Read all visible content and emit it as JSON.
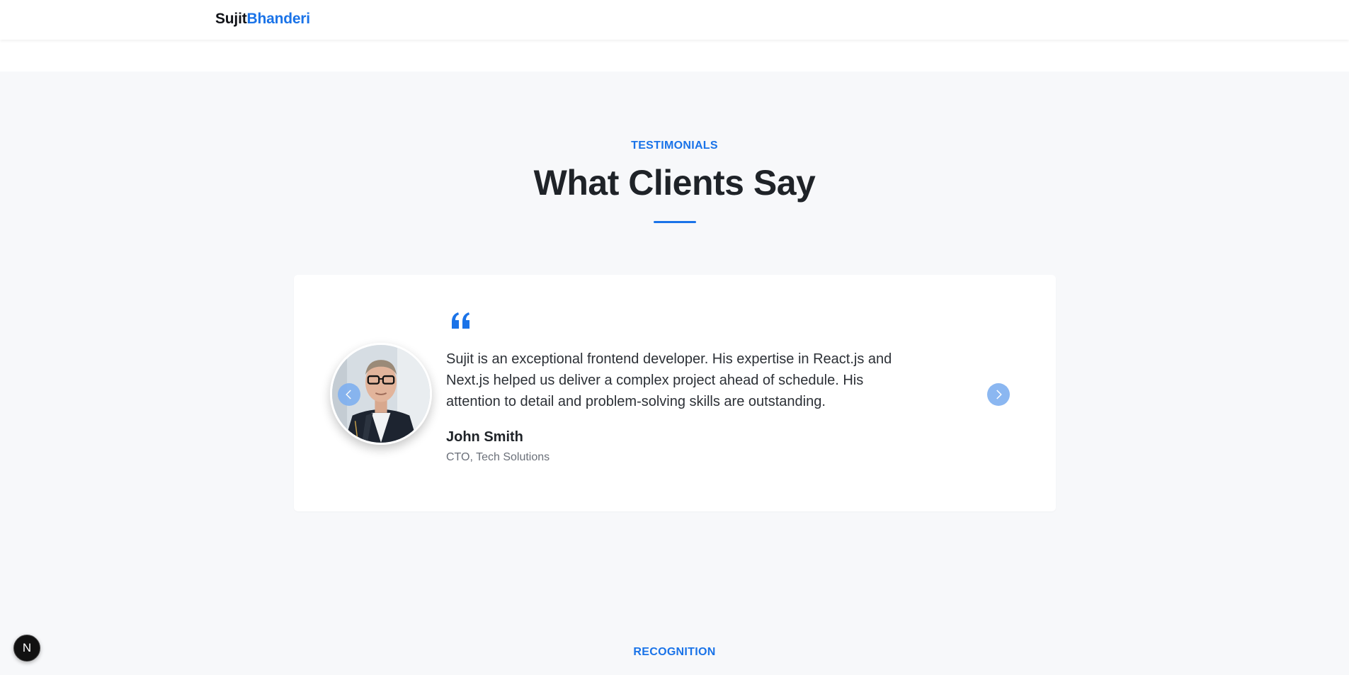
{
  "header": {
    "logo_first": "Sujit",
    "logo_last": "Bhanderi"
  },
  "testimonials": {
    "eyebrow": "TESTIMONIALS",
    "title": "What Clients Say",
    "current": {
      "quote": "Sujit is an exceptional frontend developer. His expertise in React.js and Next.js helped us deliver a complex project ahead of schedule. His attention to detail and problem-solving skills are outstanding.",
      "name": "John Smith",
      "role": "CTO, Tech Solutions"
    },
    "icons": {
      "prev": "chevron-left-icon",
      "next": "chevron-right-icon",
      "quote": "quote-icon"
    }
  },
  "recognition": {
    "eyebrow": "RECOGNITION"
  },
  "dev_badge": {
    "letter": "N"
  },
  "colors": {
    "accent": "#1a73e8",
    "section_bg": "#f7f8fa",
    "card_bg": "#ffffff",
    "nav_button": "#7fb0f0",
    "text_dark": "#1f2328",
    "text_muted": "#6b7079"
  }
}
